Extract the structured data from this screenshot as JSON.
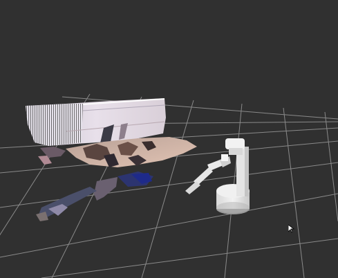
{
  "viewer": {
    "background_color": "#303030",
    "grid_color": "#a0a0a0",
    "robot_color": "#e8e8e8",
    "cursor_icon": "mouse-pointer-icon"
  }
}
